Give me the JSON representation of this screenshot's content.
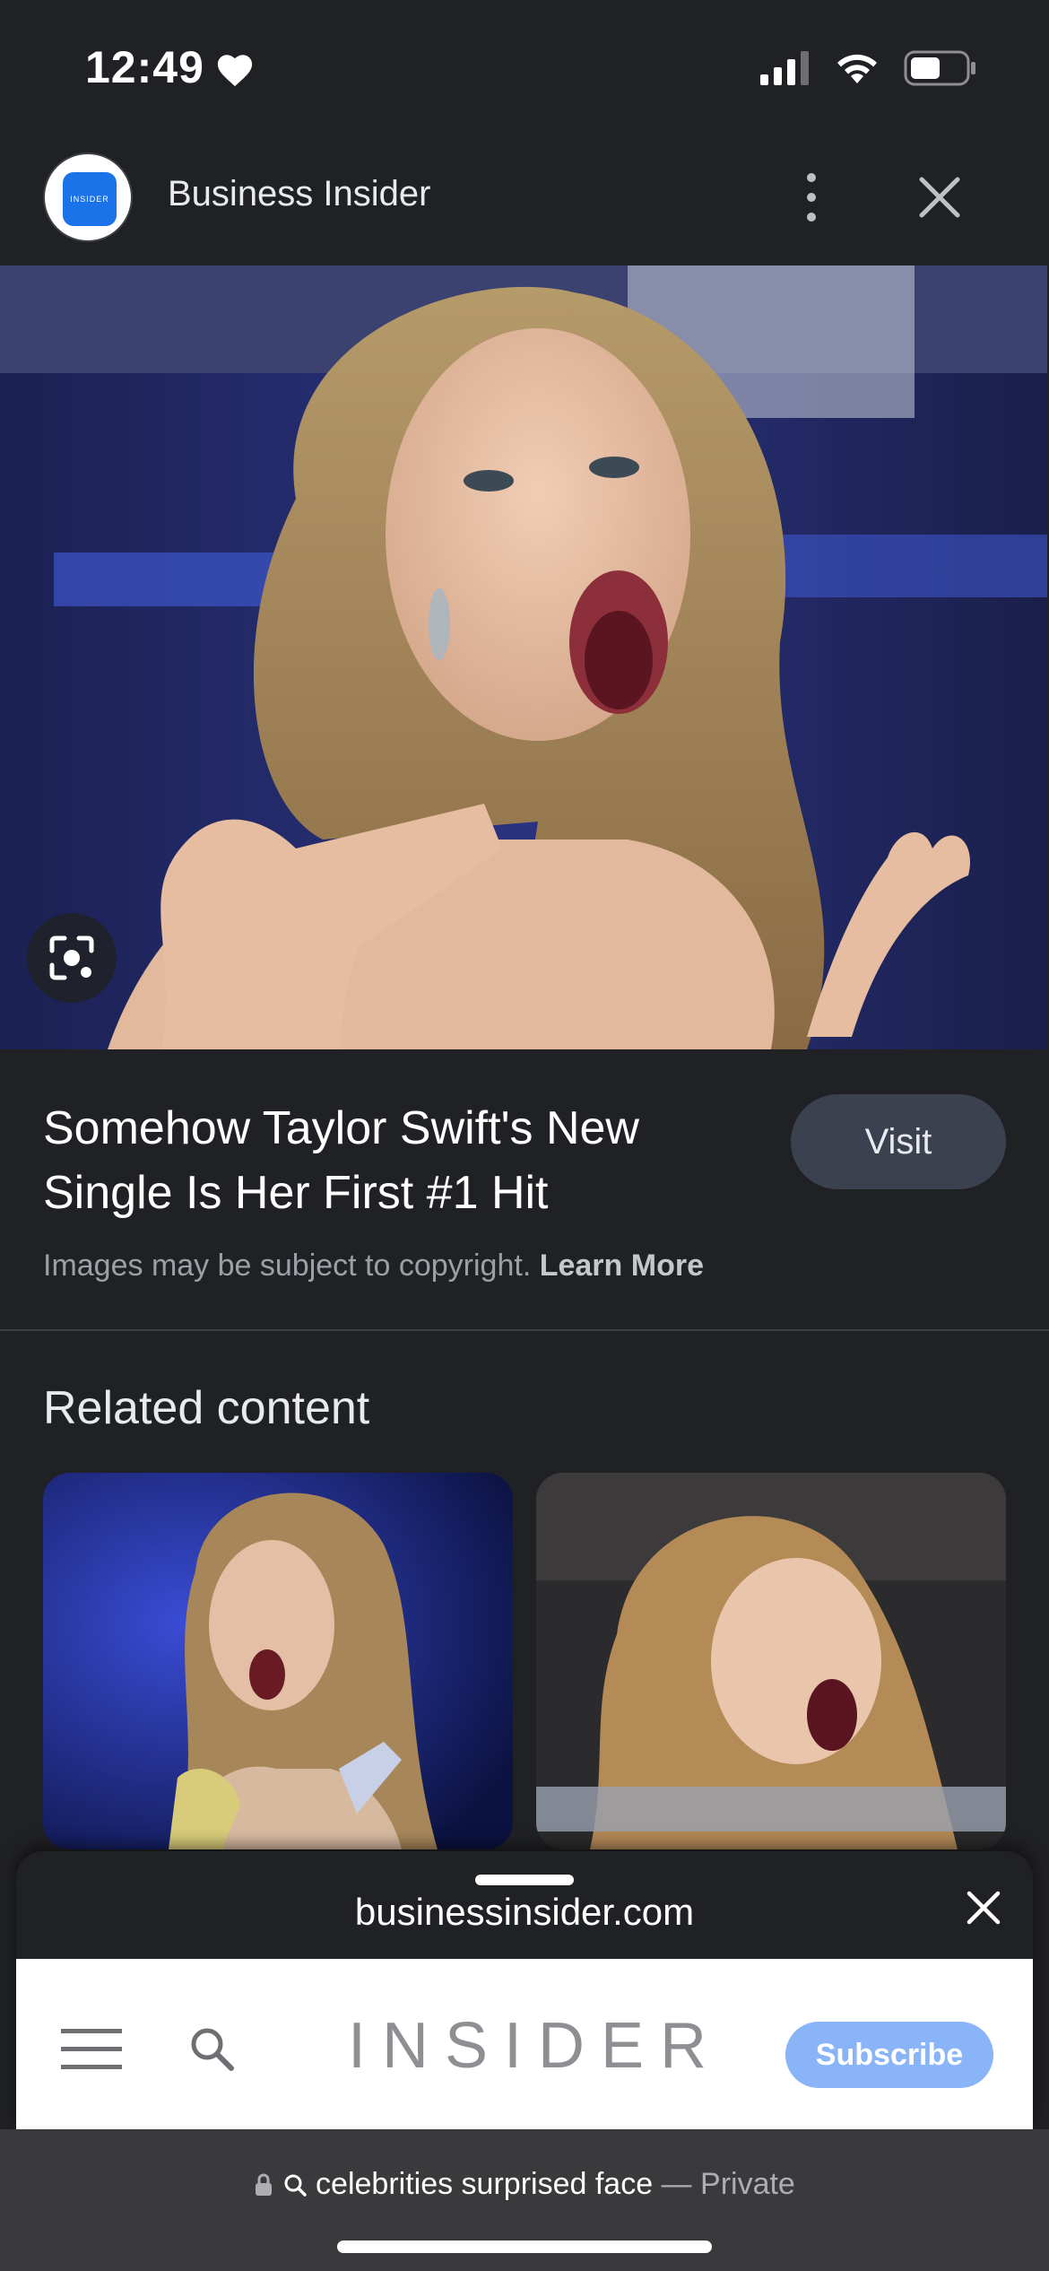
{
  "status_bar": {
    "time": "12:49"
  },
  "source": {
    "name": "Business Insider",
    "logo_text": "INSIDER"
  },
  "result": {
    "title": "Somehow Taylor Swift's New Single Is Her First #1 Hit",
    "visit_label": "Visit",
    "copyright_text": "Images may be subject to copyright.",
    "learn_more_label": "Learn More"
  },
  "related": {
    "heading": "Related content"
  },
  "sheet": {
    "url": "businessinsider.com",
    "wordmark": "INSIDER",
    "subscribe_label": "Subscribe"
  },
  "browser_bar": {
    "query": "celebrities surprised face",
    "separator": " — ",
    "mode": "Private"
  },
  "colors": {
    "background": "#202124",
    "visit_button": "#3c4150",
    "subscribe_button": "#8ab4f8",
    "bottom_bar": "#3a3a3c"
  }
}
